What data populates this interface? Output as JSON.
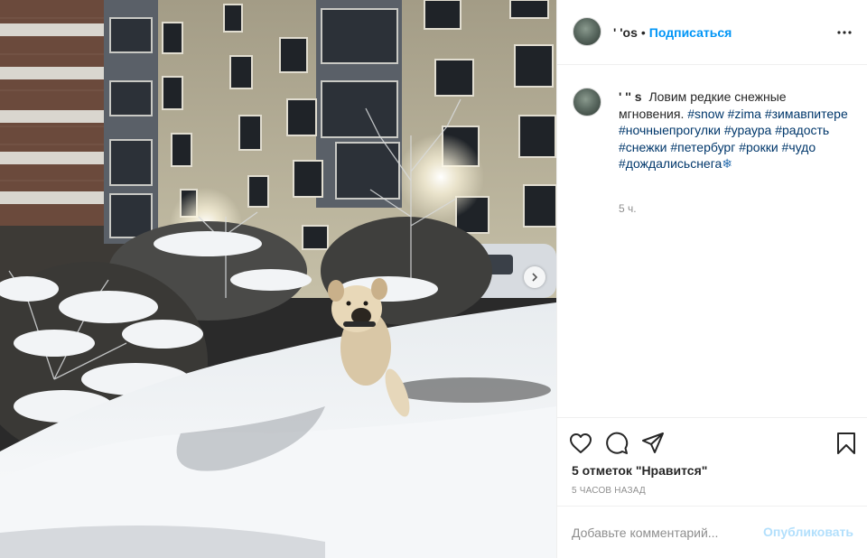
{
  "colors": {
    "accent": "#0095f6",
    "hashtag": "#00376b",
    "muted": "#8e8e8e",
    "publish_disabled": "#b2dffc"
  },
  "header": {
    "username": "'            'os",
    "separator": "•",
    "follow_label": "Подписаться",
    "more_icon": "more-horizontal-icon"
  },
  "caption": {
    "username": "'        '' s",
    "text": "Ловим редкие снежные мгновения.",
    "hashtags": [
      "#snow",
      "#zima",
      "#зимавпитере",
      "#ночныепрогулки",
      "#ураура",
      "#радость",
      "#снежки",
      "#петербург",
      "#рокки",
      "#чудо",
      "#дождалисьснега"
    ],
    "emoji": "❄",
    "time": "5 ч."
  },
  "actions": {
    "icons": [
      "heart-icon",
      "comment-icon",
      "share-icon",
      "bookmark-icon"
    ],
    "likes": "5 отметок \"Нравится\"",
    "date": "5 ЧАСОВ НАЗАД"
  },
  "comment": {
    "placeholder": "Добавьте комментарий...",
    "publish_label": "Опубликовать"
  },
  "photo": {
    "carousel_icon": "chevron-right-icon"
  }
}
